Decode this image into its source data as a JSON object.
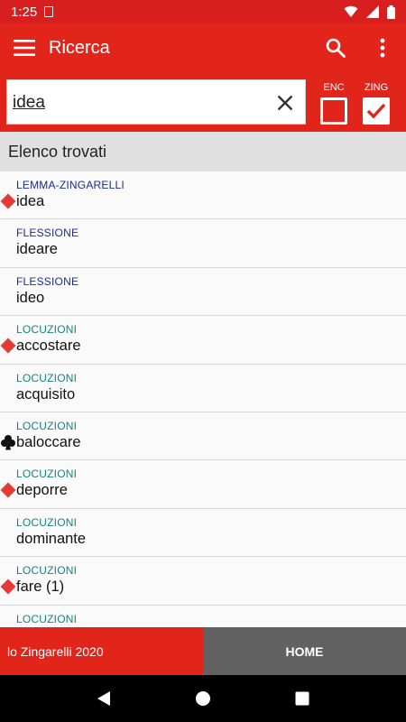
{
  "status_bar": {
    "time": "1:25"
  },
  "app_bar": {
    "title": "Ricerca"
  },
  "search": {
    "value": "idea",
    "enc_label": "ENC",
    "zing_label": "ZING",
    "enc_checked": false,
    "zing_checked": true
  },
  "results_header": "Elenco trovati",
  "results": [
    {
      "type": "LEMMA-ZINGARELLI",
      "word": "idea",
      "type_color": "navy",
      "marker": "diamond-icon"
    },
    {
      "type": "FLESSIONE",
      "word": "ideare",
      "type_color": "navy",
      "marker": ""
    },
    {
      "type": "FLESSIONE",
      "word": "ideo",
      "type_color": "navy",
      "marker": ""
    },
    {
      "type": "LOCUZIONI",
      "word": "accostare",
      "type_color": "teal",
      "marker": "diamond-icon"
    },
    {
      "type": "LOCUZIONI",
      "word": "acquisito",
      "type_color": "teal",
      "marker": ""
    },
    {
      "type": "LOCUZIONI",
      "word": "baloccare",
      "type_color": "teal",
      "marker": "club-icon"
    },
    {
      "type": "LOCUZIONI",
      "word": "deporre",
      "type_color": "teal",
      "marker": "diamond-icon"
    },
    {
      "type": "LOCUZIONI",
      "word": "dominante",
      "type_color": "teal",
      "marker": ""
    },
    {
      "type": "LOCUZIONI",
      "word": "fare (1)",
      "type_color": "teal",
      "marker": "diamond-icon"
    },
    {
      "type": "LOCUZIONI",
      "word": "",
      "type_color": "teal",
      "marker": ""
    }
  ],
  "bottom_bar": {
    "brand": "lo Zingarelli 2020",
    "home": "HOME"
  },
  "colors": {
    "primary": "#e1251b",
    "navy": "#1a2b8f",
    "teal": "#1a7f82",
    "diamond": "#e53935",
    "home_bg": "#616161"
  }
}
